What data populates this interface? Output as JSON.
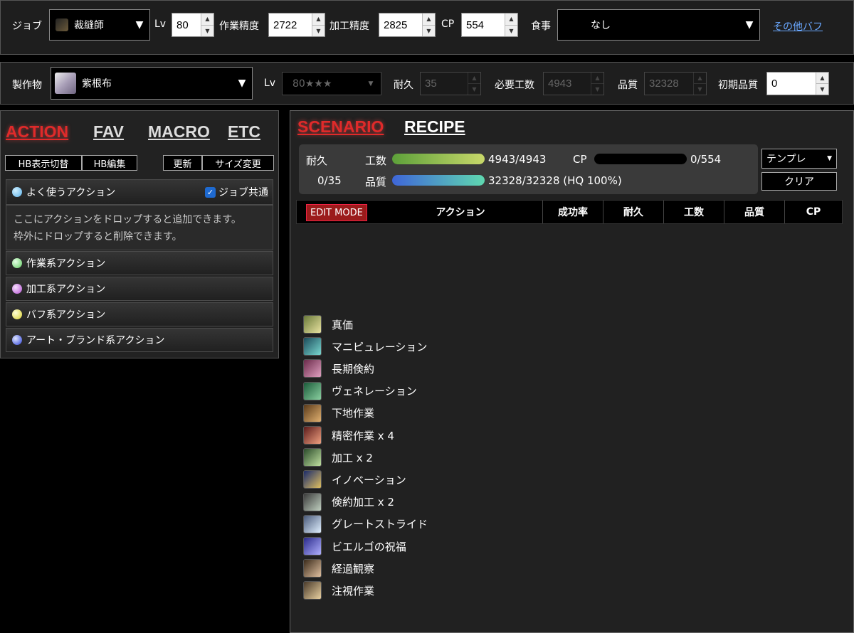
{
  "toolbar": {
    "job_label": "ジョブ",
    "job_value": "裁縫師",
    "lv_label": "Lv",
    "lv_value": "80",
    "craftsmanship_label": "作業精度",
    "craftsmanship_value": "2722",
    "control_label": "加工精度",
    "control_value": "2825",
    "cp_label": "CP",
    "cp_value": "554",
    "food_label": "食事",
    "food_value": "なし",
    "other_buffs_link": "その他バフ"
  },
  "recipe_bar": {
    "item_label": "製作物",
    "item_value": "紫根布",
    "lv_label": "Lv",
    "lv_value": "80★★★",
    "durability_label": "耐久",
    "durability_value": "35",
    "progress_label": "必要工数",
    "progress_value": "4943",
    "quality_label": "品質",
    "quality_value": "32328",
    "initial_quality_label": "初期品質",
    "initial_quality_value": "0"
  },
  "left_panel": {
    "tabs": [
      "ACTION",
      "FAV",
      "MACRO",
      "ETC"
    ],
    "buttons": [
      "HB表示切替",
      "HB編集",
      "更新",
      "サイズ変更"
    ],
    "favorites_header": "よく使うアクション",
    "shared_checkbox_label": "ジョブ共通",
    "drop_hint_line1": "ここにアクションをドロップすると追加できます。",
    "drop_hint_line2": "枠外にドロップすると削除できます。",
    "categories": [
      {
        "label": "作業系アクション",
        "color": "#7fe07f"
      },
      {
        "label": "加工系アクション",
        "color": "#d07ae0"
      },
      {
        "label": "バフ系アクション",
        "color": "#e8e85a"
      },
      {
        "label": "アート・ブランド系アクション",
        "color": "#4a5ae8"
      }
    ]
  },
  "scenario": {
    "tabs": [
      "SCENARIO",
      "RECIPE"
    ],
    "durability_label": "耐久",
    "durability_value": "0/35",
    "progress_label": "工数",
    "progress_value": "4943/4943",
    "progress_fraction": 1.0,
    "cp_label": "CP",
    "cp_value": "0/554",
    "cp_fraction": 0.0,
    "quality_label": "品質",
    "quality_value": "32328/32328 (HQ 100%)",
    "quality_fraction": 1.0,
    "template_button": "テンプレ",
    "clear_button": "クリア",
    "edit_mode_label": "EDIT MODE",
    "columns": [
      "アクション",
      "成功率",
      "耐久",
      "工数",
      "品質",
      "CP"
    ]
  },
  "macro_list": [
    {
      "label": "真価",
      "icon": "great-strides-like-icon"
    },
    {
      "label": "マニピュレーション",
      "icon": "manipulation-icon"
    },
    {
      "label": "長期倹約",
      "icon": "veneration-50-icon"
    },
    {
      "label": "ヴェネレーション",
      "icon": "veneration-icon"
    },
    {
      "label": "下地作業",
      "icon": "groundwork-icon"
    },
    {
      "label": "精密作業 x 4",
      "icon": "precise-touch-icon"
    },
    {
      "label": "加工 x 2",
      "icon": "basic-touch-icon"
    },
    {
      "label": "イノベーション",
      "icon": "innovation-icon"
    },
    {
      "label": "倹約加工 x 2",
      "icon": "prudent-touch-icon"
    },
    {
      "label": "グレートストライド",
      "icon": "great-strides-icon"
    },
    {
      "label": "ビエルゴの祝福",
      "icon": "byregots-blessing-icon"
    },
    {
      "label": "経過観察",
      "icon": "observe-icon"
    },
    {
      "label": "注視作業",
      "icon": "focused-synthesis-icon"
    }
  ]
}
